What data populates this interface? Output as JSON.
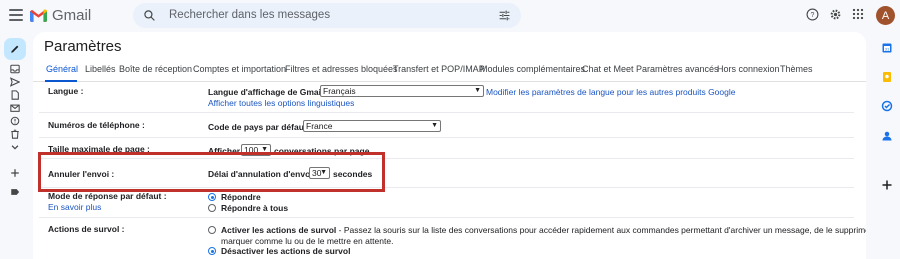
{
  "app": {
    "name": "Gmail"
  },
  "search": {
    "placeholder": "Rechercher dans les messages"
  },
  "user": {
    "avatar_letter": "A"
  },
  "colors": {
    "accent": "#0b57d0",
    "highlight": "#c0312c",
    "compose": "#c2e7ff",
    "avatar": "#a0522d"
  },
  "page": {
    "title": "Paramètres"
  },
  "tabs": [
    {
      "label": "Général",
      "active": true
    },
    {
      "label": "Libellés"
    },
    {
      "label": "Boîte de réception"
    },
    {
      "label": "Comptes et importation"
    },
    {
      "label": "Filtres et adresses bloquées"
    },
    {
      "label": "Transfert et POP/IMAP"
    },
    {
      "label": "Modules complémentaires"
    },
    {
      "label": "Chat et Meet"
    },
    {
      "label": "Paramètres avancés"
    },
    {
      "label": "Hors connexion"
    },
    {
      "label": "Thèmes"
    }
  ],
  "settings": {
    "language": {
      "label": "Langue :",
      "display_label": "Langue d'affichage de Gmail :",
      "value": "Français",
      "link_other": "Modifier les paramètres de langue pour les autres produits Google",
      "link_all": "Afficher toutes les options linguistiques"
    },
    "phone": {
      "label": "Numéros de téléphone :",
      "code_label": "Code de pays par défaut :",
      "value": "France"
    },
    "page_size": {
      "label": "Taille maximale de page :",
      "prefix": "Afficher",
      "value": "100",
      "suffix": "conversations par page"
    },
    "undo_send": {
      "label": "Annuler l'envoi :",
      "delay_label": "Délai d'annulation d'envoi :",
      "value": "30",
      "suffix": "secondes"
    },
    "reply_mode": {
      "label": "Mode de réponse par défaut :",
      "learn_more": "En savoir plus",
      "options": [
        {
          "label": "Répondre",
          "selected": true
        },
        {
          "label": "Répondre à tous",
          "selected": false
        }
      ]
    },
    "hover": {
      "label": "Actions de survol :",
      "enable_label": "Activer les actions de survol",
      "enable_desc_1": "- Passez la souris sur la liste des conversations pour accéder rapidement aux commandes permettant d'archiver un message, de le supprimer, de le",
      "enable_desc_2": "marquer comme lu ou de le mettre en attente.",
      "disable_label": "Désactiver les actions de survol",
      "enabled": false
    }
  }
}
